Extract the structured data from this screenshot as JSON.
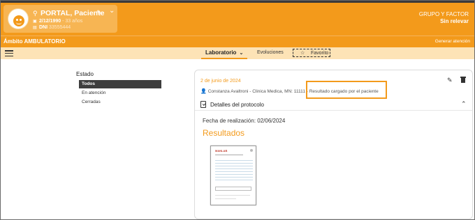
{
  "patient": {
    "name": "PORTAL, Paciente",
    "birthdate": "2/12/1990",
    "age": "- 33 años",
    "dni_label": "DNI",
    "dni": "33555444"
  },
  "header": {
    "group_title": "GRUPO Y FACTOR",
    "group_value": "Sin relevar"
  },
  "ambito": {
    "title": "Ámbito AMBULATORIO",
    "action": "Generar atención"
  },
  "tabs": {
    "laboratorio": "Laboratorio",
    "evoluciones": "Evoluciones",
    "favorito": "Favorito"
  },
  "filter": {
    "title": "Estado",
    "items": [
      "Todos",
      "En atención",
      "Cerradas"
    ]
  },
  "card": {
    "date": "2 de junio de 2024",
    "author": "Constanza Avaltroni - Clinica Medica, MN: 11111 - Resultado cargado por el paciente",
    "protocol_title": "Detalles del protocolo",
    "fecha_label": "Fecha de realización: 02/06/2024",
    "resultados_title": "Resultados",
    "doc_logo": "MANLAB"
  },
  "colors": {
    "accent": "#f39a1b",
    "tabs_bg": "#fde3b6"
  },
  "icons": [
    "face-avatar-icon",
    "location-pin-icon",
    "edit-icon",
    "chevron-down-icon",
    "menu-icon",
    "star-icon",
    "person-icon",
    "pencil-icon",
    "trash-icon",
    "clipboard-check-icon",
    "chevron-up-icon"
  ]
}
